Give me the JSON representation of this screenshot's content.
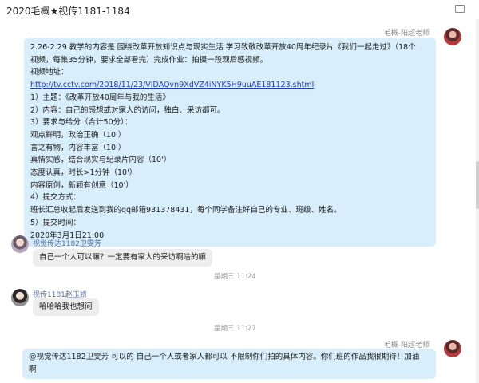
{
  "window": {
    "title": "2020毛概★视传1181-1184"
  },
  "messages": [
    {
      "sender": "毛概-阳超老师",
      "lines": [
        "2.26-2.29 教学的内容是 围绕改革开放知识点与现实生活 学习致敬改革开放40周年纪录片《我们一起走过》（18个",
        "视频，每集35分钟，要求全部看完）完成作业：拍摄一段观后感视频。",
        "视频地址：",
        "1）主题：《改革开放40周年与我的生活》",
        "2）内容：自己的感想或对家人的访问，独白、采访都可。",
        "3）要求与给分（合计50分）：",
        "观点鲜明，政治正确（10'）",
        "言之有物，内容丰富（10'）",
        "真情实感，结合现实与纪录片内容（10'）",
        "态度认真，时长>1分钟（10'）",
        "内容原创，新颖有创意（10'）",
        "4）提交方式：",
        "班长汇总收起后发送到我的qq邮箱931378431，每个同学备注好自己的专业、班级、姓名。",
        "5）提交时间：",
        "2020年3月1日21:00"
      ],
      "link": "http://tv.cctv.com/2018/11/23/VIDAQvn9XdVZ4iNYK5H9uuAE181123.shtml"
    },
    {
      "sender": "视觉传达1182卫雯芳",
      "text": "自己一个人可以嘛？一定要有家人的采访啊啥的嘛"
    },
    {
      "time": "星期三  11:24"
    },
    {
      "sender": "视传1181赵玉娇",
      "text": "哈哈哈我也想问"
    },
    {
      "time": "星期三  11:27"
    },
    {
      "sender": "毛概-阳超老师",
      "lines": [
        "@视觉传达1182卫雯芳 可以的 自己一个人或者家人都可以 不限制你们拍的具体内容。你们班的作品我很期待！加油",
        "啊"
      ]
    }
  ]
}
